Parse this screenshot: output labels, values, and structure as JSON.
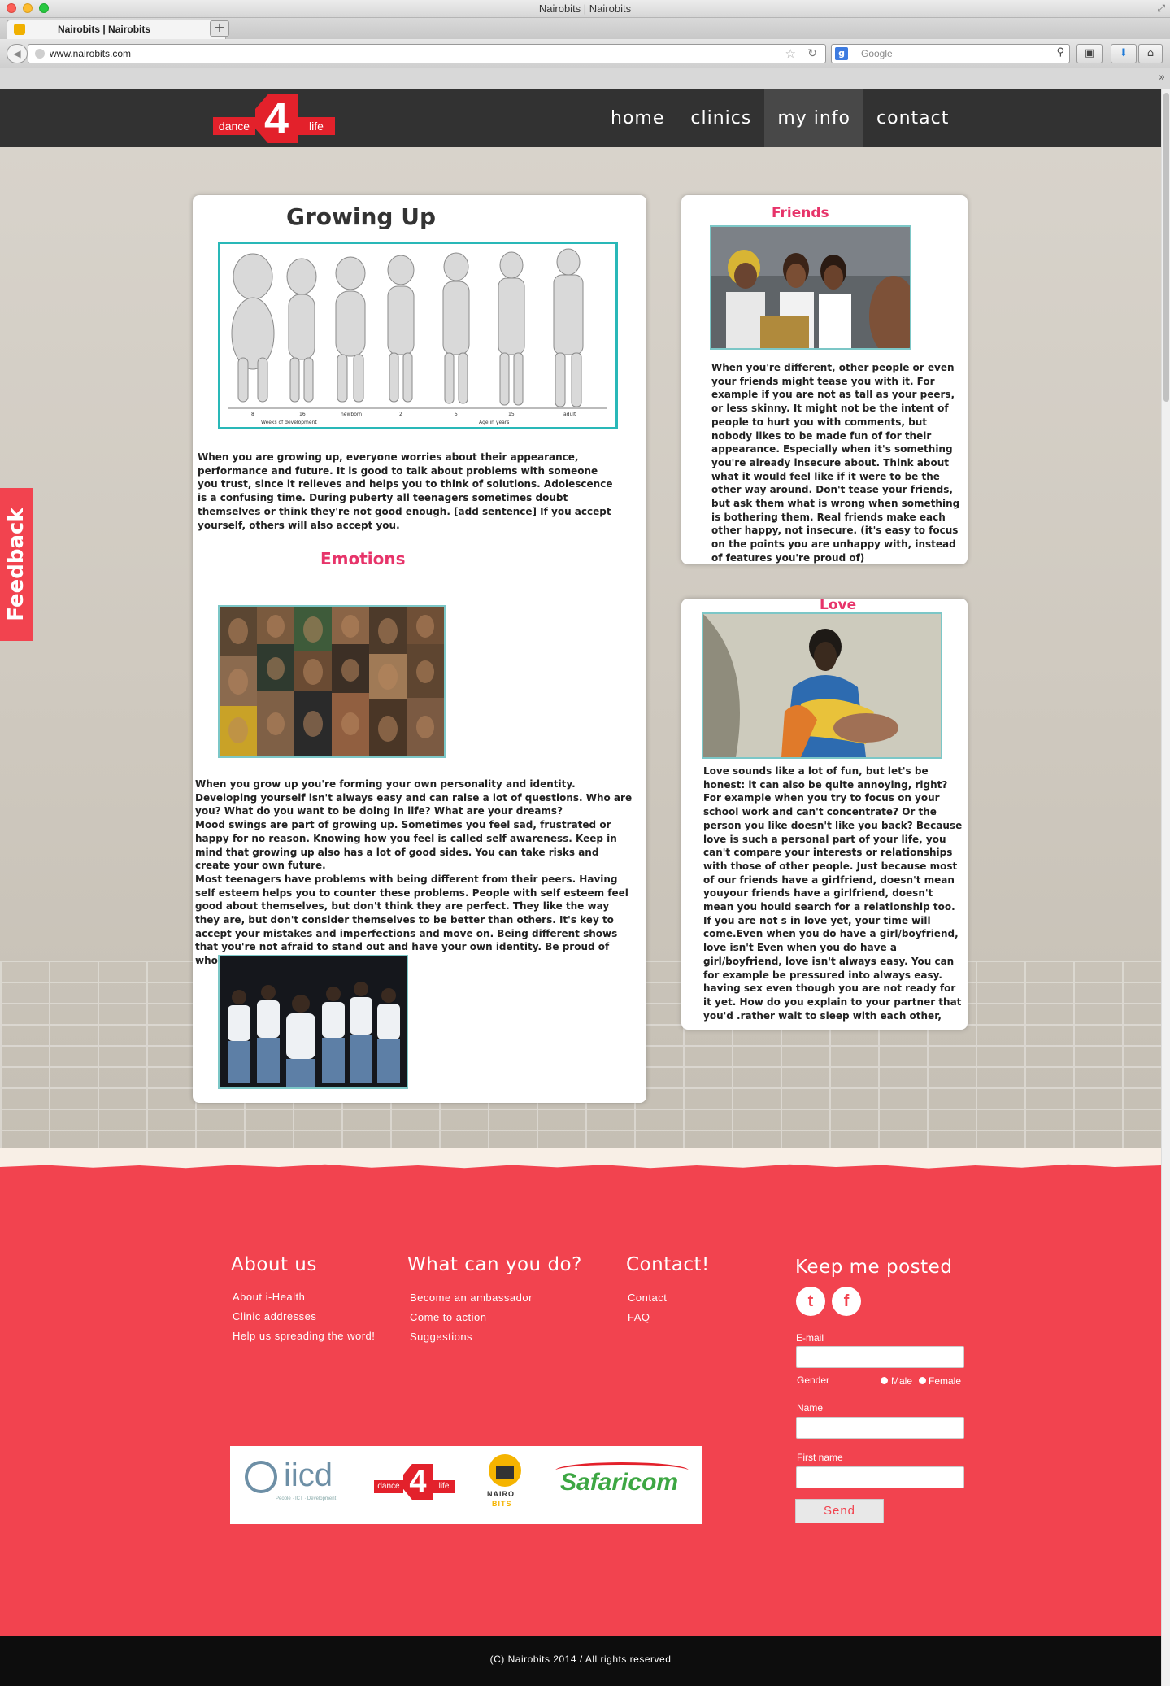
{
  "browser": {
    "window_title": "Nairobits | Nairobits",
    "tab_title": "Nairobits | Nairobits",
    "url": "www.nairobits.com",
    "search_placeholder": "Google",
    "new_tab": "+"
  },
  "header": {
    "logo": {
      "left": "dance",
      "middle": "4",
      "right": "life"
    },
    "nav": [
      {
        "label": "home"
      },
      {
        "label": "clinics"
      },
      {
        "label": "my info"
      },
      {
        "label": "contact"
      }
    ],
    "active_nav": "my info"
  },
  "feedback": {
    "label": "Feedback"
  },
  "growing_up": {
    "title": "Growing Up",
    "diagram_labels": [
      "8",
      "16",
      "newborn",
      "2",
      "5",
      "15",
      "adult"
    ],
    "axis_left": "Weeks of development",
    "axis_right": "Age in years",
    "paragraph": "When you are growing up, everyone worries about their appearance, performance and future. It is good to talk about problems with someone you trust, since it relieves and helps you to think of solutions. Adolescence is a confusing time. During puberty all teenagers sometimes doubt themselves or think they're not good enough. [add sentence] If you accept yourself, others will also accept you."
  },
  "emotions": {
    "title": "Emotions",
    "paragraph": "When you grow up you're forming your own personality and identity. Developing yourself isn't always easy and can raise a lot of questions. Who are you? What do you want to be doing in life? What are your dreams?\nMood swings are part of growing up. Sometimes you feel sad, frustrated or happy for no reason. Knowing how you feel is called self awareness. Keep in mind that growing up also has a lot of good sides. You can take risks and create your own future.\nMost teenagers have problems with being different from their peers. Having self esteem helps you to counter these problems. People with self esteem feel good about themselves, but don't think they are perfect. They like the way they are, but don't consider themselves to be better than others. It's key to accept your mistakes and imperfections and move on. Being different shows that you're not afraid to stand out and have your own identity. Be proud of who you are, nobody's perfect."
  },
  "friends": {
    "title": "Friends",
    "paragraph": "When you're different, other people or even your friends might tease you with it. For example if you are not as tall as your peers, or less skinny. It might not be the intent of people to hurt you with comments, but nobody likes to be made fun of for their appearance. Especially when it's something you're already insecure about. Think about what it would feel like if it were to be the other way around. Don't tease your friends, but ask them what is wrong when something is bothering them. Real friends make each other happy, not insecure. (it's easy to focus on the points you are unhappy with, instead of features you're proud of)"
  },
  "love": {
    "title": "Love",
    "paragraph": "Love sounds like a lot of fun, but let's be honest: it can also be quite annoying, right? For example when you try to focus on your school work and can't concentrate? Or the person you like doesn't like you back? Because love is such a personal part of your life, you can't compare your interests or relationships with those of other people. Just because most of our friends have a girlfriend, doesn't mean youyour friends have a girlfriend, doesn't mean you hould search for a relationship too. If you are not s in love yet, your time will come.Even when you do have a girl/boyfriend, love isn't Even when you do have a girl/boyfriend, love isn't always easy. You can for example be pressured into always easy. having sex even though you are not ready for it  yet. How do you explain to your partner that you'd .rather wait to sleep with each other, when he /she doesn't see the problem? You have to realize that love is not"
  },
  "footer": {
    "about": {
      "heading": "About us",
      "links": [
        "About i-Health",
        "Clinic addresses",
        "Help us spreading the word!"
      ]
    },
    "what": {
      "heading": "What can you do?",
      "links": [
        "Become an ambassador",
        "Come to action",
        "Suggestions"
      ]
    },
    "contact": {
      "heading": "Contact!",
      "links": [
        "Contact",
        "FAQ"
      ]
    },
    "keep_posted": {
      "heading": "Keep me posted",
      "twitter": "t",
      "facebook": "f",
      "email_label": "E-mail",
      "gender_label": "Gender",
      "male": "Male",
      "female": "Female",
      "name_label": "Name",
      "first_name_label": "First name",
      "send": "Send"
    },
    "sponsors": {
      "iicd": "iicd",
      "iicd_tag": "People · ICT · Development",
      "d4l_left": "dance",
      "d4l_mid": "4",
      "d4l_right": "life",
      "nairobits_top": "NAIRO",
      "nairobits_bottom": "BITS",
      "safaricom": "Safaricom"
    },
    "copyright": "(C) Nairobits 2014  / All rights reserved"
  },
  "colors": {
    "accent_pink": "#e7346a",
    "footer_red": "#f2434f",
    "header_dark": "#323232",
    "image_border_teal": "#29b8b8"
  }
}
